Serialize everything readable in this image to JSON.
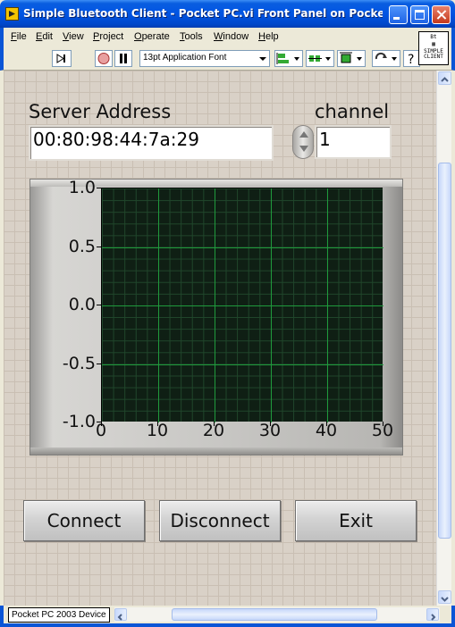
{
  "window": {
    "title": "Simple Bluetooth Client - Pocket PC.vi Front Panel on Pocket P..."
  },
  "menu": {
    "items": [
      "File",
      "Edit",
      "View",
      "Project",
      "Operate",
      "Tools",
      "Window",
      "Help"
    ]
  },
  "toolbar": {
    "font": "13pt Application Font",
    "icons": [
      "run-arrow-icon",
      "abort-icon",
      "pause-icon",
      "align-icon",
      "distribute-icon",
      "resize-icon",
      "reorder-icon",
      "help-icon"
    ]
  },
  "vi_icon_text": [
    "Bt",
    "SIMPLE",
    "CLIENT"
  ],
  "panel": {
    "server_address_label": "Server Address",
    "server_address_value": "00:80:98:44:7a:29",
    "channel_label": "channel",
    "channel_value": "1"
  },
  "chart_data": {
    "type": "line",
    "title": "",
    "xlabel": "",
    "ylabel": "",
    "xlim": [
      0,
      50
    ],
    "ylim": [
      -1.0,
      1.0
    ],
    "x_ticks": [
      "0",
      "10",
      "20",
      "30",
      "40",
      "50"
    ],
    "y_ticks": [
      "1.0",
      "0.5",
      "0.0",
      "-0.5",
      "-1.0"
    ],
    "series": [],
    "grid": true,
    "background": "#0f1f14",
    "grid_color": "#1f9a3c"
  },
  "buttons": {
    "connect": "Connect",
    "disconnect": "Disconnect",
    "exit": "Exit"
  },
  "status": {
    "device": "Pocket PC 2003 Device"
  }
}
